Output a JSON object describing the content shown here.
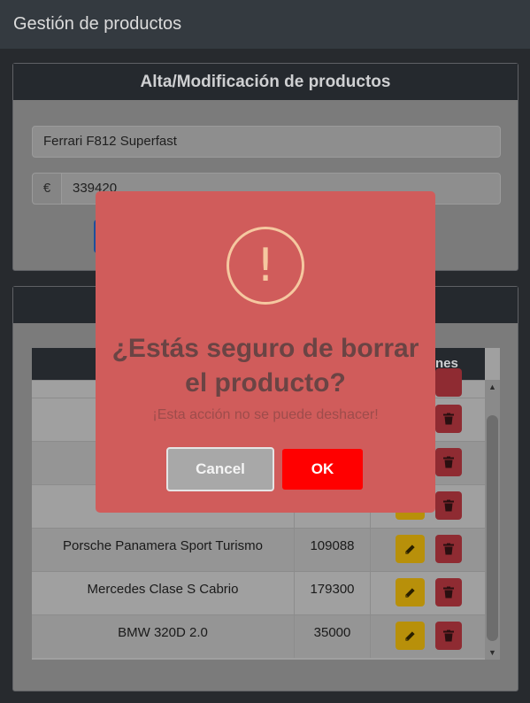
{
  "navbar": {
    "title": "Gestión de productos"
  },
  "form": {
    "header": "Alta/Modificación de productos",
    "name_value": "Ferrari F812 Superfast",
    "currency_prefix": "€",
    "price_value": "339420"
  },
  "table": {
    "actions_header": "Acciones",
    "rows": [
      {
        "name": "Porsche Panamera Sport Turismo",
        "price": "109088"
      },
      {
        "name": "Mercedes Clase S Cabrio",
        "price": "179300"
      },
      {
        "name": "BMW 320D 2.0",
        "price": "35000"
      }
    ]
  },
  "icons": {
    "edit": "edit-icon",
    "delete": "trash-icon",
    "warning": "exclamation-icon"
  },
  "modal": {
    "icon_glyph": "!",
    "title": "¿Estás seguro de borrar el producto?",
    "text": "¡Esta acción no se puede deshacer!",
    "cancel_label": "Cancel",
    "ok_label": "OK"
  },
  "colors": {
    "modal_bg": "#d05c5b",
    "ok_button": "#ff0000",
    "edit_button": "#b8900a",
    "delete_button": "#8f2b32"
  }
}
